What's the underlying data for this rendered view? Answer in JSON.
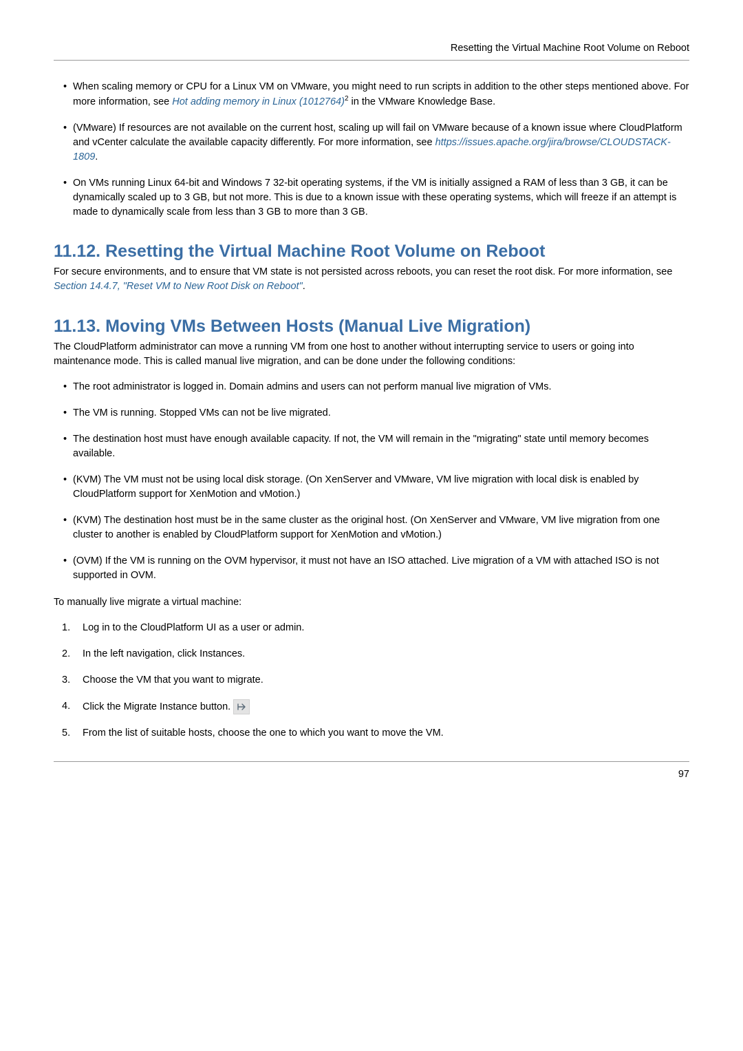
{
  "header": {
    "running": "Resetting the Virtual Machine Root Volume on Reboot"
  },
  "topBullets": [
    {
      "before": "When scaling memory or CPU for a Linux VM on VMware, you might need to run scripts in addition to the other steps mentioned above. For more information, see ",
      "link": "Hot adding memory in Linux (1012764)",
      "sup": "2",
      "after": " in the VMware Knowledge Base."
    },
    {
      "before": "(VMware) If resources are not available on the current host, scaling up will fail on VMware because of a known issue where CloudPlatform and vCenter calculate the available capacity differently. For more information, see ",
      "link": "https://issues.apache.org/jira/browse/CLOUDSTACK-1809",
      "after": "."
    },
    {
      "before": "On VMs running Linux 64-bit and Windows 7 32-bit operating systems, if the VM is initially assigned a RAM of less than 3 GB, it can be dynamically scaled up to 3 GB, but not more. This is due to a known issue with these operating systems, which will freeze if an attempt is made to dynamically scale from less than 3 GB to more than 3 GB."
    }
  ],
  "sec1": {
    "title": "11.12. Resetting the Virtual Machine Root Volume on Reboot",
    "p_before": "For secure environments, and to ensure that VM state is not persisted across reboots, you can reset the root disk. For more information, see ",
    "p_link": "Section 14.4.7, \"Reset VM to New Root Disk on Reboot\"",
    "p_after": "."
  },
  "sec2": {
    "title": "11.13. Moving VMs Between Hosts (Manual Live Migration)",
    "intro": "The CloudPlatform administrator can move a running VM from one host to another without interrupting service to users or going into maintenance mode. This is called manual live migration, and can be done under the following conditions:",
    "bullets": [
      "The root administrator is logged in. Domain admins and users can not perform manual live migration of VMs.",
      "The VM is running. Stopped VMs can not be live migrated.",
      "The destination host must have enough available capacity. If not, the VM will remain in the \"migrating\" state until memory becomes available.",
      "(KVM) The VM must not be using local disk storage. (On XenServer and VMware, VM live migration with local disk is enabled by CloudPlatform support for XenMotion and vMotion.)",
      "(KVM) The destination host must be in the same cluster as the original host. (On XenServer and VMware, VM live migration from one cluster to another is enabled by CloudPlatform support for XenMotion and vMotion.)",
      "(OVM) If the VM is running on the OVM hypervisor, it must not have an ISO attached. Live migration of a VM with attached ISO is not supported in OVM."
    ],
    "outro": "To manually live migrate a virtual machine:",
    "steps": {
      "s1": "Log in to the CloudPlatform UI as a user or admin.",
      "s2": "In the left navigation, click Instances.",
      "s3": "Choose the VM that you want to migrate.",
      "s4": "Click the Migrate Instance button.",
      "s5": "From the list of suitable hosts, choose the one to which you want to move the VM."
    }
  },
  "footer": {
    "pagenum": "97"
  }
}
